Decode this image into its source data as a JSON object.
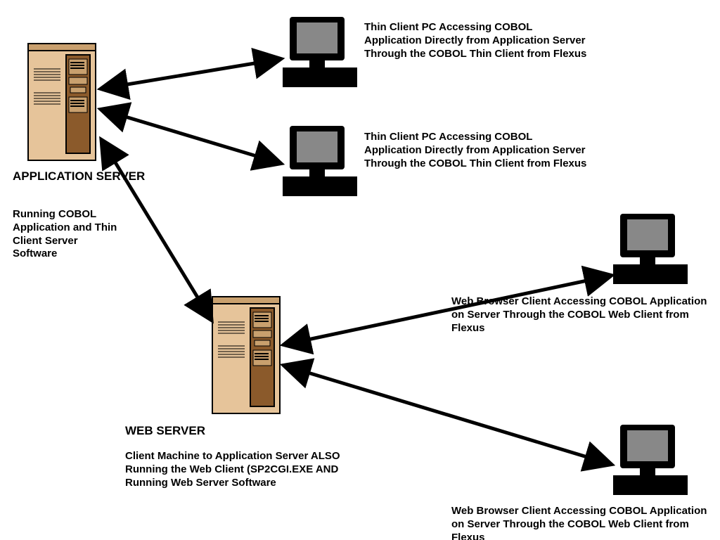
{
  "appServer": {
    "title": "APPLICATION SERVER",
    "desc": "Running COBOL Application and Thin Client Server Software"
  },
  "webServer": {
    "title": "WEB SERVER",
    "desc": "Client Machine to Application Server ALSO Running the Web Client (SP2CGI.EXE AND Running Web Server Software"
  },
  "thinClient1": "Thin Client PC Accessing COBOL Application Directly from Application Server Through the COBOL Thin Client from Flexus",
  "thinClient2": "Thin Client PC Accessing COBOL Application Directly from Application Server Through the COBOL Thin Client from Flexus",
  "webClient1": "Web Browser Client Accessing COBOL Application on Server Through the COBOL Web Client from Flexus",
  "webClient2": "Web Browser Client Accessing COBOL Application on Server Through the COBOL Web Client from Flexus",
  "icons": {
    "server": "server-icon",
    "pc": "computer-icon"
  }
}
